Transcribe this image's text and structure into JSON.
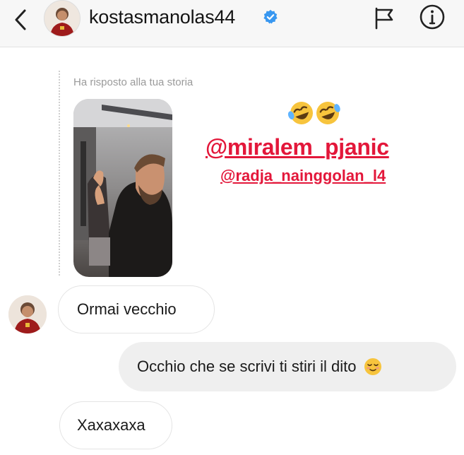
{
  "header": {
    "username": "kostasmanolas44",
    "icons": [
      "back-arrow-icon",
      "verified-badge-icon",
      "flag-icon",
      "info-icon"
    ]
  },
  "story_reply": {
    "caption": "Ha risposto alla tua storia",
    "mention_primary": "@miralem_pjanic",
    "mention_secondary": "@radja_nainggolan_l4",
    "emoji": "🤣🤣"
  },
  "messages": [
    {
      "direction": "incoming",
      "text": "Ormai vecchio"
    },
    {
      "direction": "outgoing",
      "text": "Occhio che se scrivi ti stiri il dito",
      "emoji": "😌"
    },
    {
      "direction": "incoming",
      "text": "Xaxaxaxa"
    }
  ],
  "colors": {
    "mention": "#e3173a",
    "verified": "#3897f0",
    "outgoing_bubble": "#efefef",
    "header_bg": "#f7f7f7"
  }
}
